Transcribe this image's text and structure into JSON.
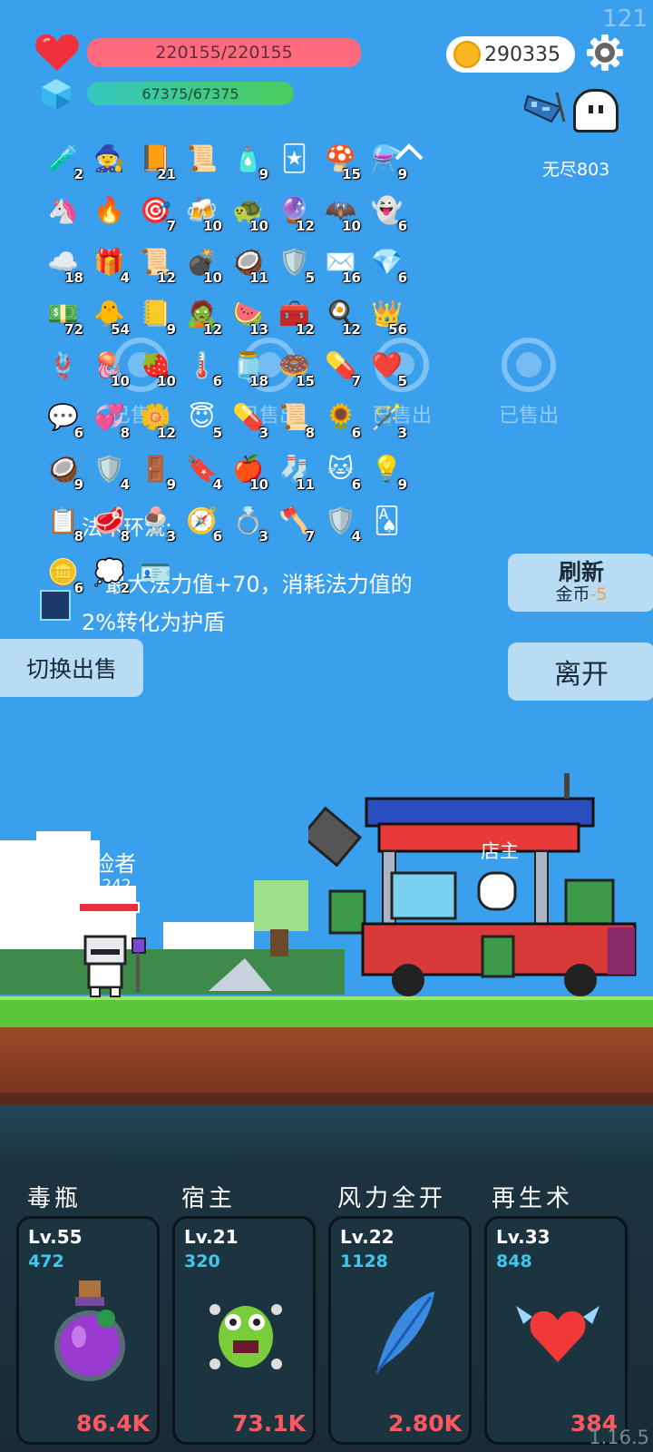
{
  "fps": "121",
  "hp": "220155/220155",
  "mp": "67375/67375",
  "coins": "290335",
  "endless": "无尽803",
  "inventory": [
    [
      [
        "🧪",
        "2"
      ],
      [
        "🧙",
        ""
      ],
      [
        "📙",
        "21"
      ],
      [
        "📜",
        ""
      ],
      [
        "🧴",
        "9"
      ],
      [
        "🃏",
        ""
      ],
      [
        "🍄",
        "15"
      ],
      [
        "⚗️",
        "9"
      ]
    ],
    [
      [
        "🦄",
        ""
      ],
      [
        "🔥",
        ""
      ],
      [
        "🎯",
        "7"
      ],
      [
        "🍻",
        "10"
      ],
      [
        "🐢",
        "10"
      ],
      [
        "🔮",
        "12"
      ],
      [
        "🦇",
        "10"
      ],
      [
        "👻",
        "6"
      ]
    ],
    [
      [
        "☁️",
        "18"
      ],
      [
        "🎁",
        "4"
      ],
      [
        "📜",
        "12"
      ],
      [
        "💣",
        "10"
      ],
      [
        "🥥",
        "11"
      ],
      [
        "🛡️",
        "5"
      ],
      [
        "✉️",
        "16"
      ],
      [
        "💎",
        "6"
      ]
    ],
    [
      [
        "💵",
        "72"
      ],
      [
        "🐥",
        "54"
      ],
      [
        "📒",
        "9"
      ],
      [
        "🧟",
        "12"
      ],
      [
        "🍉",
        "13"
      ],
      [
        "🧰",
        "12"
      ],
      [
        "🍳",
        "12"
      ],
      [
        "👑",
        "56"
      ]
    ],
    [
      [
        "🪢",
        ""
      ],
      [
        "🪼",
        "10"
      ],
      [
        "🍓",
        "10"
      ],
      [
        "🌡️",
        "6"
      ],
      [
        "🫙",
        "18"
      ],
      [
        "🍩",
        "15"
      ],
      [
        "💊",
        "7"
      ],
      [
        "❤️",
        "5"
      ]
    ],
    [
      [
        "💬",
        "6"
      ],
      [
        "💞",
        "8"
      ],
      [
        "🌼",
        "12"
      ],
      [
        "😇",
        "5"
      ],
      [
        "💊",
        "3"
      ],
      [
        "📜",
        "8"
      ],
      [
        "🌻",
        "6"
      ],
      [
        "🪄",
        "3"
      ]
    ],
    [
      [
        "🥥",
        "9"
      ],
      [
        "🛡️",
        "4"
      ],
      [
        "🚪",
        "9"
      ],
      [
        "🔖",
        "4"
      ],
      [
        "🍎",
        "10"
      ],
      [
        "🧦",
        "11"
      ],
      [
        "🐱",
        "6"
      ],
      [
        "💡",
        "9"
      ]
    ],
    [
      [
        "📋",
        "8"
      ],
      [
        "🥩",
        "8"
      ],
      [
        "🍨",
        "3"
      ],
      [
        "🧭",
        "6"
      ],
      [
        "💍",
        "3"
      ],
      [
        "🪓",
        "7"
      ],
      [
        "🛡️",
        "4"
      ],
      [
        "🂡",
        ""
      ]
    ],
    [
      [
        "🪙",
        "6"
      ],
      [
        "💭",
        "2"
      ],
      [
        "🪪",
        ""
      ]
    ]
  ],
  "sold_label": "已售出",
  "desc": {
    "title": "法术环流:",
    "line1": "最大法力值+70，消耗法力值的",
    "line2": "2%转化为护盾"
  },
  "buttons": {
    "refresh": "刷新",
    "refresh_cost_prefix": "金币",
    "refresh_cost": "-5",
    "leave": "离开",
    "switch_sell": "切换出售"
  },
  "player": {
    "name": "冒险者",
    "level": "lv. 242"
  },
  "shopkeeper": "店主",
  "skills": [
    {
      "name": "毒瓶",
      "level": "Lv.55",
      "value": "472",
      "damage": "86.4K",
      "icon": "poison-bottle-icon"
    },
    {
      "name": "宿主",
      "level": "Lv.21",
      "value": "320",
      "damage": "73.1K",
      "icon": "green-monster-icon"
    },
    {
      "name": "风力全开",
      "level": "Lv.22",
      "value": "1128",
      "damage": "2.80K",
      "icon": "feather-icon"
    },
    {
      "name": "再生术",
      "level": "Lv.33",
      "value": "848",
      "damage": "384",
      "icon": "winged-heart-icon"
    }
  ],
  "version": "1.16.5"
}
